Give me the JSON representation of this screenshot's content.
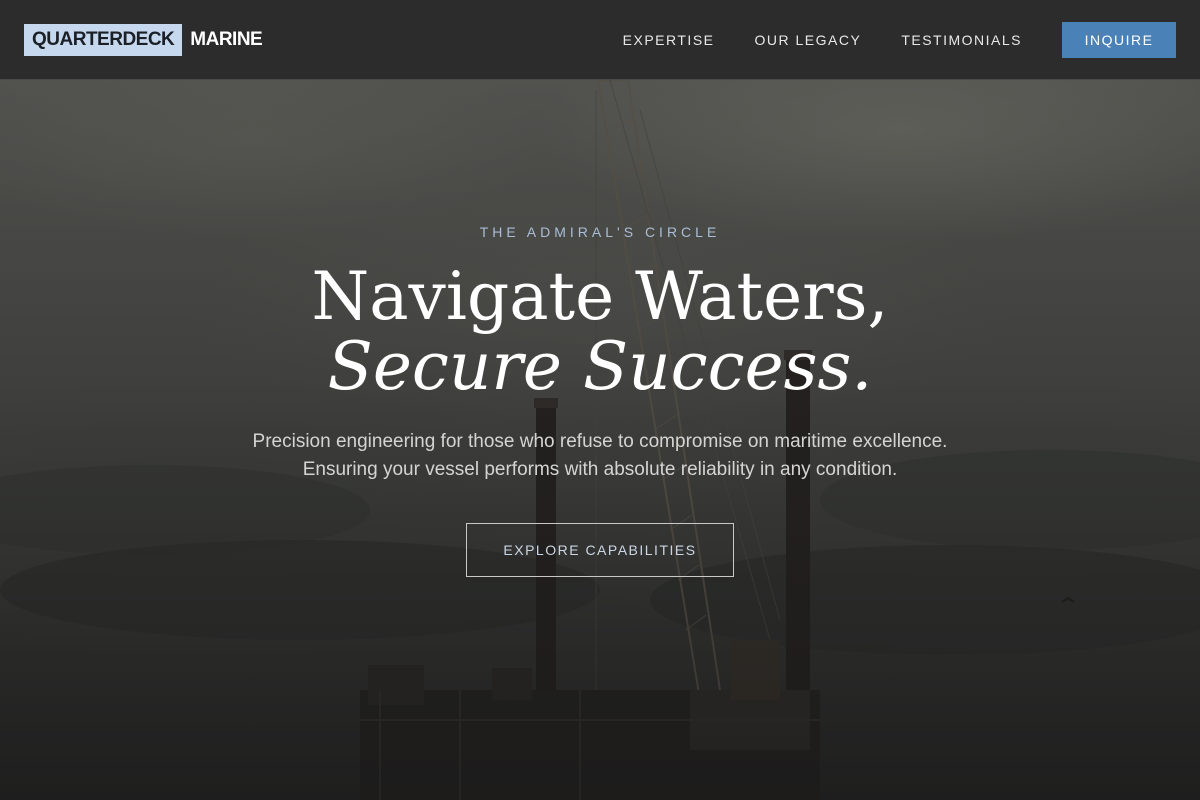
{
  "brand": {
    "logo_box_text": "QUARTERDECK",
    "logo_text": "MARINE",
    "logo_box_color": "#c5d8ee"
  },
  "nav": {
    "items": [
      {
        "label": "EXPERTISE"
      },
      {
        "label": "OUR LEGACY"
      },
      {
        "label": "TESTIMONIALS"
      }
    ],
    "cta_label": "INQUIRE",
    "cta_color": "#4a82b8"
  },
  "hero": {
    "eyebrow": "THE ADMIRAL'S CIRCLE",
    "headline_line1": "Navigate Waters,",
    "headline_line2": "Secure Success.",
    "subcopy_line1": "Precision engineering for those who refuse to compromise on maritime excellence.",
    "subcopy_line2": "Ensuring your vessel performs with absolute reliability in any condition.",
    "button_label": "EXPLORE CAPABILITIES",
    "background_image": "offshore-rig-crane-photo"
  }
}
